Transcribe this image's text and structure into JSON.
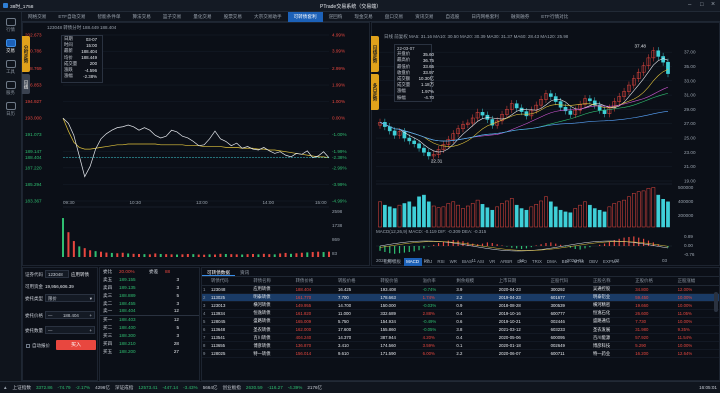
{
  "app": {
    "user": "38时_1758",
    "window_title": "PTrade交易系统（交易端）",
    "datetime": "16:05:01"
  },
  "nav": {
    "tabs": [
      "网格交易",
      "ETF自动交易",
      "智能条件单",
      "算法交易",
      "篮子交易",
      "量化交易",
      "股票交易",
      "大宗交易助手",
      "可转债套利",
      "逆回购",
      "现金交易",
      "盘口交易",
      "资讯交易",
      "自选股",
      "日内网格套利",
      "融资融券",
      "ETF行情对比"
    ],
    "active_index": 8
  },
  "sidebar": {
    "items": [
      "行情",
      "交易",
      "工具",
      "服务",
      "日历"
    ],
    "active_index": 1
  },
  "vtabs": {
    "left_a": "分时走势",
    "left_b": "日线",
    "right_a": "日线走势",
    "right_b": "多日走势"
  },
  "intraday": {
    "header": "123048  转债分时  188.449  188.404",
    "info_rows": [
      [
        "日期",
        "03-07"
      ],
      [
        "时间",
        "15:00"
      ],
      [
        "最新",
        "188.404"
      ],
      [
        "均价",
        "188.449"
      ],
      [
        "成交量",
        "200"
      ],
      [
        "涨跌",
        "-4.596"
      ],
      [
        "涨幅",
        "-2.38%"
      ]
    ],
    "y_left": [
      "202.673",
      "200.786",
      "198.769",
      "196.853",
      "194.927",
      "193.000",
      "191.073",
      "189.147",
      "188.404",
      "187.220",
      "185.294",
      "183.367"
    ],
    "y_right": [
      "4.99%",
      "3.99%",
      "2.99%",
      "1.99%",
      "1.00%",
      "0.00%",
      "-1.00%",
      "-1.99%",
      "-2.38%",
      "-2.99%",
      "-3.99%",
      "-4.99%"
    ],
    "vol_axis": [
      "2598",
      "1738",
      "869",
      "83"
    ],
    "time_axis": [
      "09:30",
      "10:30",
      "13:00",
      "14:00",
      "15:00"
    ],
    "price_series": [
      193.0,
      192.4,
      191.0,
      188.6,
      186.2,
      187.4,
      189.4,
      190.6,
      191.2,
      191.6,
      191.9,
      192.0,
      192.2,
      192.0,
      191.6,
      191.9,
      191.6,
      191.0,
      190.7,
      190.9,
      191.6,
      191.4,
      190.9,
      190.7,
      190.3,
      189.8,
      189.9,
      190.6,
      191.5,
      190.6,
      190.3,
      189.8,
      190.1,
      189.5,
      189.7,
      189.4,
      189.3,
      189.6,
      189.2,
      188.9,
      189.1,
      188.7,
      188.5,
      188.9,
      188.8,
      189.2,
      188.4,
      188.6,
      189.1,
      188.4
    ],
    "avg_series": [
      193.0,
      191.5,
      190.2,
      189.6,
      189.4,
      189.4,
      189.5,
      189.6,
      189.7,
      189.8,
      189.9,
      189.9,
      190.0,
      190.0,
      190.0,
      190.0,
      190.0,
      190.0,
      189.9,
      189.9,
      189.9,
      189.9,
      189.9,
      189.8,
      189.8,
      189.8,
      189.7,
      189.7,
      189.7,
      189.7,
      189.6,
      189.6,
      189.6,
      189.5,
      189.5,
      189.5,
      189.4,
      189.4,
      189.3,
      189.3,
      189.2,
      189.1,
      189.0,
      188.9,
      188.8,
      188.7,
      188.6,
      188.5,
      188.5,
      188.4
    ],
    "volume": [
      2200,
      1400,
      900,
      600,
      500,
      380,
      330,
      300,
      250,
      230,
      210,
      240,
      200,
      180,
      170,
      160,
      150,
      200,
      170,
      160,
      150,
      140,
      150,
      170,
      160,
      140,
      130,
      150,
      140,
      180,
      170,
      160,
      150,
      140,
      160,
      170,
      150,
      180,
      160,
      150,
      200,
      230,
      180,
      210,
      240,
      260,
      280,
      300,
      280,
      300
    ]
  },
  "daily": {
    "header": "日线  前复权  MA5: 31.16  MA10: 30.50  MA20: 30.39  MA30: 31.37  MA60: 28.43  MA120: 25.98",
    "info_rows": [
      [
        "22-03-07",
        ""
      ],
      [
        "开盘价",
        "35.60"
      ],
      [
        "最高价",
        "36.75"
      ],
      [
        "最低价",
        "33.65"
      ],
      [
        "收盘价",
        "33.97"
      ],
      [
        "成交额",
        "10.30亿"
      ],
      [
        "成交量",
        "1.18万"
      ],
      [
        "涨幅",
        "1.97%"
      ],
      [
        "振幅",
        "-4.70"
      ]
    ],
    "y_right": [
      "37.00",
      "35.00",
      "33.00",
      "31.00",
      "29.00",
      "27.00",
      "25.00",
      "23.00",
      "21.00",
      "19.00"
    ],
    "high_label": "37.48",
    "low_label": "22.31",
    "vol_axis": [
      "500000",
      "400000",
      "200000"
    ],
    "macd_header": "MACD(12,26,9)  MACD: -0.119  DIF: -0.309  DEA: -0.315",
    "macd_axis": [
      "0.89",
      "0.00",
      "-0.76"
    ],
    "time_axis": [
      "2021-09",
      "10",
      "11",
      "12",
      "2022-01",
      "02",
      "03"
    ],
    "closes": [
      27.2,
      26.6,
      26.0,
      25.4,
      25.9,
      25.0,
      24.6,
      24.2,
      23.6,
      23.0,
      22.5,
      22.7,
      23.4,
      24.1,
      24.8,
      25.6,
      26.3,
      26.9,
      27.1,
      27.8,
      28.6,
      28.2,
      27.6,
      26.8,
      27.4,
      28.3,
      29.0,
      29.8,
      29.2,
      28.7,
      28.1,
      28.9,
      29.6,
      30.4,
      31.2,
      30.8,
      30.1,
      29.3,
      28.8,
      28.3,
      28.9,
      29.7,
      30.5,
      30.2,
      29.6,
      28.9,
      28.4,
      29.2,
      30.1,
      30.8,
      31.5,
      32.4,
      33.3,
      34.2,
      35.1,
      36.2,
      37.2,
      36.4,
      35.6,
      34.0
    ],
    "volume": [
      300,
      260,
      240,
      220,
      260,
      280,
      300,
      240,
      360,
      380,
      300,
      250,
      230,
      240,
      280,
      300,
      260,
      220,
      250,
      280,
      320,
      270,
      230,
      200,
      240,
      280,
      310,
      340,
      260,
      220,
      200,
      240,
      270,
      310,
      360,
      300,
      240,
      200,
      180,
      170,
      220,
      260,
      300,
      260,
      220,
      200,
      180,
      240,
      280,
      300,
      320,
      360,
      400,
      420,
      430,
      460,
      470,
      380,
      330,
      300
    ],
    "macd": [
      -0.4,
      -0.5,
      -0.6,
      -0.65,
      -0.6,
      -0.55,
      -0.5,
      -0.45,
      -0.35,
      -0.2,
      -0.05,
      0.1,
      0.25,
      0.35,
      0.45,
      0.5,
      0.45,
      0.4,
      0.3,
      0.2,
      0.15,
      0.2,
      0.3,
      0.25,
      0.15,
      0.05,
      -0.05,
      -0.15,
      -0.2,
      -0.25,
      -0.2,
      -0.1,
      0.05,
      0.15,
      0.25,
      0.3,
      0.2,
      0.1,
      -0.05,
      -0.15,
      -0.25,
      -0.3,
      -0.2,
      -0.1,
      0.0,
      0.1,
      0.2,
      0.35,
      0.5,
      0.6,
      0.7,
      0.75,
      0.8,
      0.7,
      0.6,
      0.45,
      0.3,
      0.15,
      0.0,
      -0.12
    ]
  },
  "indicator_tabs": [
    "指标模板",
    "MACD",
    "KDJ",
    "RSI",
    "WR",
    "BIAS",
    "ASI",
    "VR",
    "ARBR",
    "DPO",
    "TRIX",
    "DMA",
    "BBI",
    "MTM",
    "OBV",
    "EXPMA"
  ],
  "order": {
    "code_label": "证券代码",
    "code": "123048",
    "name": "应用转债",
    "avail_label": "可用资金",
    "avail": "19,956,606.39",
    "price_type_label": "委托类型",
    "price_type": "限价",
    "price_label": "委托价格",
    "price": "188.404",
    "qty_label": "委托数量",
    "qty": "",
    "auto_label": "自动报价",
    "buy_label": "买入",
    "minus": "—",
    "plus": "+"
  },
  "book": {
    "header_left": "委比",
    "ratio": "20.00%",
    "header_mid": "委差",
    "diff": "88",
    "asks": [
      [
        "卖五",
        "189.155",
        "3"
      ],
      [
        "卖四",
        "189.135",
        "3"
      ],
      [
        "卖三",
        "188.889",
        "5"
      ],
      [
        "卖二",
        "188.455",
        "3"
      ],
      [
        "卖一",
        "188.404",
        "12"
      ]
    ],
    "bids": [
      [
        "买一",
        "188.403",
        "12"
      ],
      [
        "买二",
        "188.400",
        "5"
      ],
      [
        "买三",
        "188.300",
        "3"
      ],
      [
        "买四",
        "188.210",
        "28"
      ],
      [
        "买五",
        "188.200",
        "27"
      ]
    ]
  },
  "bondtable": {
    "tabs": [
      "可转债数据",
      "资讯"
    ],
    "columns": [
      "转债代码",
      "转债名称",
      "转债价格",
      "转股价格",
      "转股价值",
      "溢价率",
      "剩余规模",
      "上市日期",
      "正股代码",
      "正股名称",
      "正股价格",
      "正股涨幅"
    ],
    "rows": [
      [
        "123048",
        "应用转债",
        "188.404",
        "16.425",
        "193.408",
        "-0.74%",
        "3.9",
        "2020-04-23",
        "300292",
        "吴通控股",
        "34.800",
        "12.00%"
      ],
      [
        "113025",
        "明泰转债",
        "161.770",
        "7.700",
        "178.663",
        "1.74%",
        "2.2",
        "2019-04-23",
        "601677",
        "明泰铝业",
        "59.450",
        "10.00%"
      ],
      [
        "123013",
        "横河转债",
        "149.955",
        "14.700",
        "150.000",
        "-0.03%",
        "0.9",
        "2018-08-28",
        "300539",
        "横河精密",
        "19.660",
        "10.00%"
      ],
      [
        "113934",
        "恒逸转债",
        "161.820",
        "11.000",
        "332.689",
        "2.88%",
        "0.4",
        "2019-10-16",
        "600777",
        "恒逸石化",
        "26.600",
        "11.05%"
      ],
      [
        "128045",
        "盛路转债",
        "165.009",
        "5.750",
        "154.934",
        "-0.49%",
        "0.6",
        "2019-10-21",
        "002446",
        "盛路通信",
        "7.730",
        "10.00%"
      ],
      [
        "113648",
        "圣农转债",
        "162.000",
        "17.600",
        "155.860",
        "-0.05%",
        "3.8",
        "2021-03-12",
        "603233",
        "圣农发展",
        "31.980",
        "9.35%"
      ],
      [
        "113541",
        "百川转债",
        "404.240",
        "14.370",
        "387.944",
        "4.20%",
        "0.4",
        "2020-05-06",
        "600095",
        "百川能源",
        "57.920",
        "11.54%"
      ],
      [
        "113655",
        "博彦转债",
        "136.870",
        "3.410",
        "174.560",
        "3.59%",
        "0.1",
        "2020-01-18",
        "002649",
        "博彦科技",
        "5.290",
        "10.00%"
      ],
      [
        "128025",
        "特一转债",
        "156.014",
        "9.610",
        "171.590",
        "6.00%",
        "2.2",
        "2020-06-07",
        "600711",
        "特一药业",
        "16.200",
        "12.64%"
      ]
    ],
    "selected_index": 1
  },
  "status": {
    "sh_label": "上证指数",
    "sh_value": "3372.86",
    "sh_chg": "-74.79",
    "sh_pct": "-2.17%",
    "sh_amt": "4296亿",
    "sz_label": "深证成指",
    "sz_value": "12573.41",
    "sz_chg": "-447.14",
    "sz_pct": "-3.43%",
    "sz_amt": "5664亿",
    "cy_label": "创业板指",
    "cy_value": "2630.59",
    "cy_chg": "-116.27",
    "cy_pct": "-4.39%",
    "cy_amt": "2176亿"
  },
  "colors": {
    "up": "#e8473f",
    "down": "#2fbf71",
    "accent": "#1c61b8",
    "avg_line": "#e2c43c",
    "price_line": "#e6e9ee"
  }
}
